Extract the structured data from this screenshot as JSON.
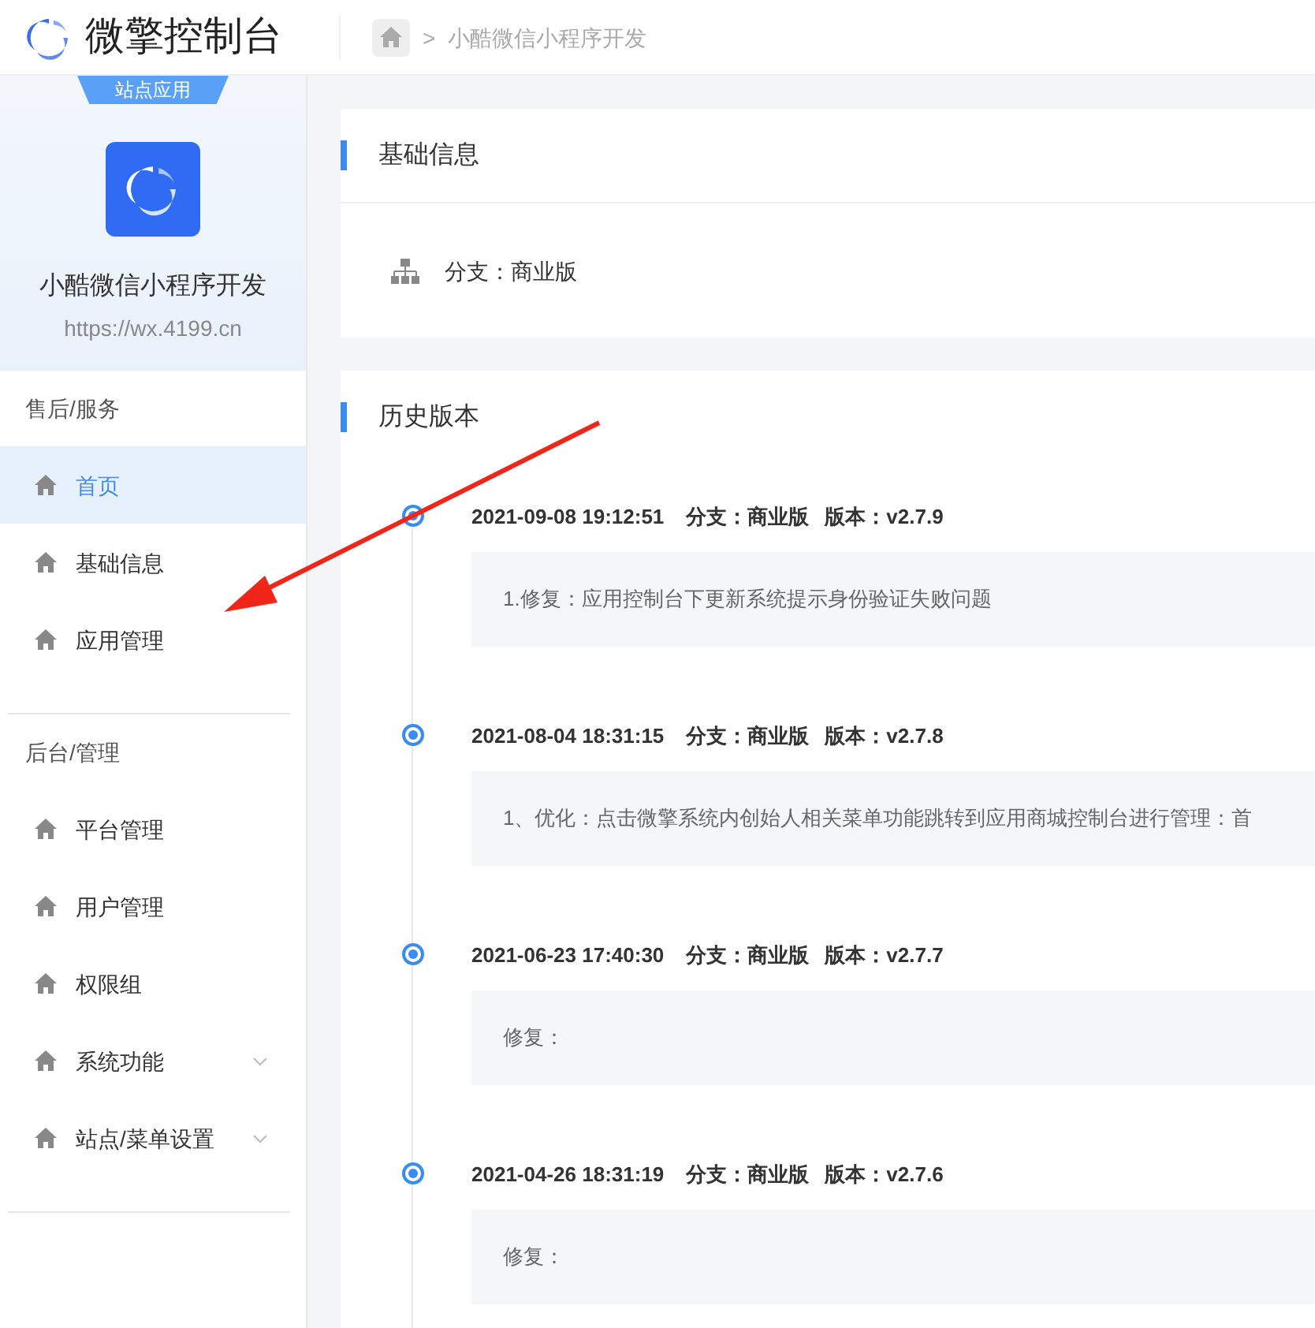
{
  "header": {
    "brand": "微擎控制台",
    "breadcrumb_separator": ">",
    "breadcrumb": "小酷微信小程序开发"
  },
  "site": {
    "tag": "站点应用",
    "name": "小酷微信小程序开发",
    "url": "https://wx.4199.cn"
  },
  "sidebar": {
    "sections": [
      {
        "title": "售后/服务",
        "items": [
          {
            "label": "首页",
            "selected": true,
            "expandable": false
          },
          {
            "label": "基础信息",
            "selected": false,
            "expandable": false
          },
          {
            "label": "应用管理",
            "selected": false,
            "expandable": false
          }
        ]
      },
      {
        "title": "后台/管理",
        "items": [
          {
            "label": "平台管理",
            "selected": false,
            "expandable": false
          },
          {
            "label": "用户管理",
            "selected": false,
            "expandable": false
          },
          {
            "label": "权限组",
            "selected": false,
            "expandable": false
          },
          {
            "label": "系统功能",
            "selected": false,
            "expandable": true
          },
          {
            "label": "站点/菜单设置",
            "selected": false,
            "expandable": true
          }
        ]
      }
    ]
  },
  "basic_info": {
    "title": "基础信息",
    "branch": "分支：商业版"
  },
  "history": {
    "title": "历史版本",
    "entries": [
      {
        "time": "2021-09-08 19:12:51",
        "branch": "分支：商业版",
        "version": "版本：v2.7.9",
        "note": "1.修复：应用控制台下更新系统提示身份验证失败问题"
      },
      {
        "time": "2021-08-04 18:31:15",
        "branch": "分支：商业版",
        "version": "版本：v2.7.8",
        "note": "1、优化：点击微擎系统内创始人相关菜单功能跳转到应用商城控制台进行管理：首"
      },
      {
        "time": "2021-06-23 17:40:30",
        "branch": "分支：商业版",
        "version": "版本：v2.7.7",
        "note": "修复："
      },
      {
        "time": "2021-04-26 18:31:19",
        "branch": "分支：商业版",
        "version": "版本：v2.7.6",
        "note": "修复："
      }
    ]
  }
}
